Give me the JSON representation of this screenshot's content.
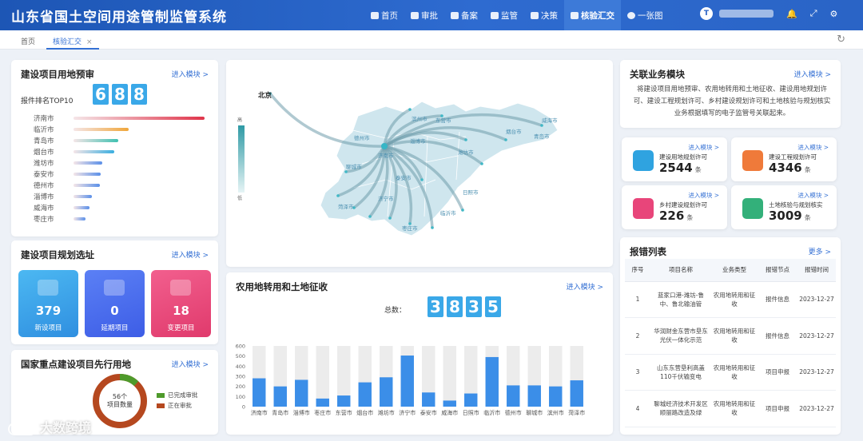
{
  "header": {
    "app_title": "山东省国土空间用途管制监管系统",
    "nav": [
      {
        "label": "首页",
        "icon": "home-icon",
        "active": false
      },
      {
        "label": "审批",
        "icon": "gavel-icon",
        "active": false
      },
      {
        "label": "备案",
        "icon": "record-icon",
        "active": false
      },
      {
        "label": "监管",
        "icon": "shield-icon",
        "active": false
      },
      {
        "label": "决策",
        "icon": "users-icon",
        "active": false
      },
      {
        "label": "核验汇交",
        "icon": "database-icon",
        "active": true
      },
      {
        "label": "一张图",
        "icon": "globe-icon",
        "active": false
      }
    ],
    "avatar_letter": "T"
  },
  "tabs": [
    {
      "label": "首页"
    },
    {
      "label": "核验汇交",
      "close": "×"
    }
  ],
  "preview": {
    "title": "建设项目用地预审",
    "link": "进入模块 >",
    "digits": [
      "6",
      "8",
      "8"
    ],
    "rank_title": "报件排名TOP10",
    "rank": [
      {
        "name": "济南市",
        "value": 100
      },
      {
        "name": "临沂市",
        "value": 42
      },
      {
        "name": "青岛市",
        "value": 34
      },
      {
        "name": "烟台市",
        "value": 31
      },
      {
        "name": "潍坊市",
        "value": 22
      },
      {
        "name": "泰安市",
        "value": 21
      },
      {
        "name": "德州市",
        "value": 20
      },
      {
        "name": "淄博市",
        "value": 14
      },
      {
        "name": "威海市",
        "value": 12
      },
      {
        "name": "枣庄市",
        "value": 9
      }
    ]
  },
  "planning": {
    "title": "建设项目规划选址",
    "link": "进入模块 >",
    "stats": [
      {
        "value": "379",
        "label": "新设项目",
        "color": "#38a6ea"
      },
      {
        "value": "0",
        "label": "延期项目",
        "color": "#4f6df0"
      },
      {
        "value": "18",
        "label": "变更项目",
        "color": "#e9457a"
      }
    ]
  },
  "priority": {
    "title": "国家重点建设项目先行用地",
    "link": "进入模块 >",
    "center_count": "56个",
    "center_label": "项目数量",
    "legend": [
      {
        "label": "已完成审批",
        "color": "#4e9a2b"
      },
      {
        "label": "正在审批",
        "color": "#b5481f"
      }
    ],
    "completed_ratio": 0.12
  },
  "map": {
    "beijing_label": "北京",
    "scale_high": "高",
    "scale_low": "低",
    "cities": [
      "济南市",
      "青岛市",
      "淄博市",
      "枣庄市",
      "东营市",
      "烟台市",
      "潍坊市",
      "济宁市",
      "泰安市",
      "威海市",
      "日照市",
      "临沂市",
      "德州市",
      "聊城市",
      "滨州市",
      "菏泽市"
    ]
  },
  "farmland": {
    "title": "农用地转用和土地征收",
    "link": "进入模块 >",
    "total_label": "总数：",
    "digits": [
      "3",
      "8",
      "3",
      "5"
    ]
  },
  "related": {
    "title": "关联业务模块",
    "link": "进入模块 >",
    "description": "将建设项目用地预审、农用地转用和土地征收、建设用地规划许可、建设工程规划许可、乡村建设规划许可和土地核验与规划核实业务根据填写的电子监管号关联起来。",
    "cards": [
      {
        "name": "建设用地规划许可",
        "value": "2544",
        "unit": "条",
        "link": "进入模块 >",
        "color": "#2fa3e0",
        "icon": "document-icon"
      },
      {
        "name": "建设工程规划许可",
        "value": "4346",
        "unit": "条",
        "link": "进入模块 >",
        "color": "#ef7a3a",
        "icon": "worker-icon"
      },
      {
        "name": "乡村建设规划许可",
        "value": "226",
        "unit": "条",
        "link": "进入模块 >",
        "color": "#e8457a",
        "icon": "house-icon"
      },
      {
        "name": "土地核验与规划核实",
        "value": "3009",
        "unit": "条",
        "link": "进入模块 >",
        "color": "#33b07a",
        "icon": "map-pin-icon"
      }
    ]
  },
  "errors": {
    "title": "报错列表",
    "link": "更多 >",
    "columns": [
      "序号",
      "项目名称",
      "业务类型",
      "报错节点",
      "报错时间"
    ],
    "rows": [
      {
        "no": "1",
        "name": "蓝家口港-潍坊-鲁中、鲁北输油管",
        "type": "农用地转用和征收",
        "node": "报件信息",
        "time": "2023-12-27"
      },
      {
        "no": "2",
        "name": "华润财金东营市垦东光伏一体化示范",
        "type": "农用地转用和征收",
        "node": "报件信息",
        "time": "2023-12-27"
      },
      {
        "no": "3",
        "name": "山东东营垦利高盖110千伏输变电",
        "type": "农用地转用和征收",
        "node": "项目申报",
        "time": "2023-12-27"
      },
      {
        "no": "4",
        "name": "聊城经济技术开发区顺丽路改造及绿",
        "type": "农用地转用和征收",
        "node": "项目申报",
        "time": "2023-12-27"
      }
    ]
  },
  "chart_data": {
    "type": "bar",
    "categories": [
      "济南市",
      "青岛市",
      "淄博市",
      "枣庄市",
      "东营市",
      "烟台市",
      "潍坊市",
      "济宁市",
      "泰安市",
      "威海市",
      "日照市",
      "临沂市",
      "德州市",
      "聊城市",
      "滨州市",
      "菏泽市"
    ],
    "values": [
      280,
      200,
      265,
      80,
      110,
      240,
      290,
      505,
      140,
      60,
      130,
      490,
      210,
      210,
      200,
      260
    ],
    "ylim": [
      0,
      600
    ],
    "yticks": [
      "0",
      "100",
      "200",
      "300",
      "400",
      "500",
      "600"
    ],
    "bar_color": "#3b8ee8",
    "bg_color": "#ececec",
    "grid": false
  },
  "watermark": "大数跨境"
}
